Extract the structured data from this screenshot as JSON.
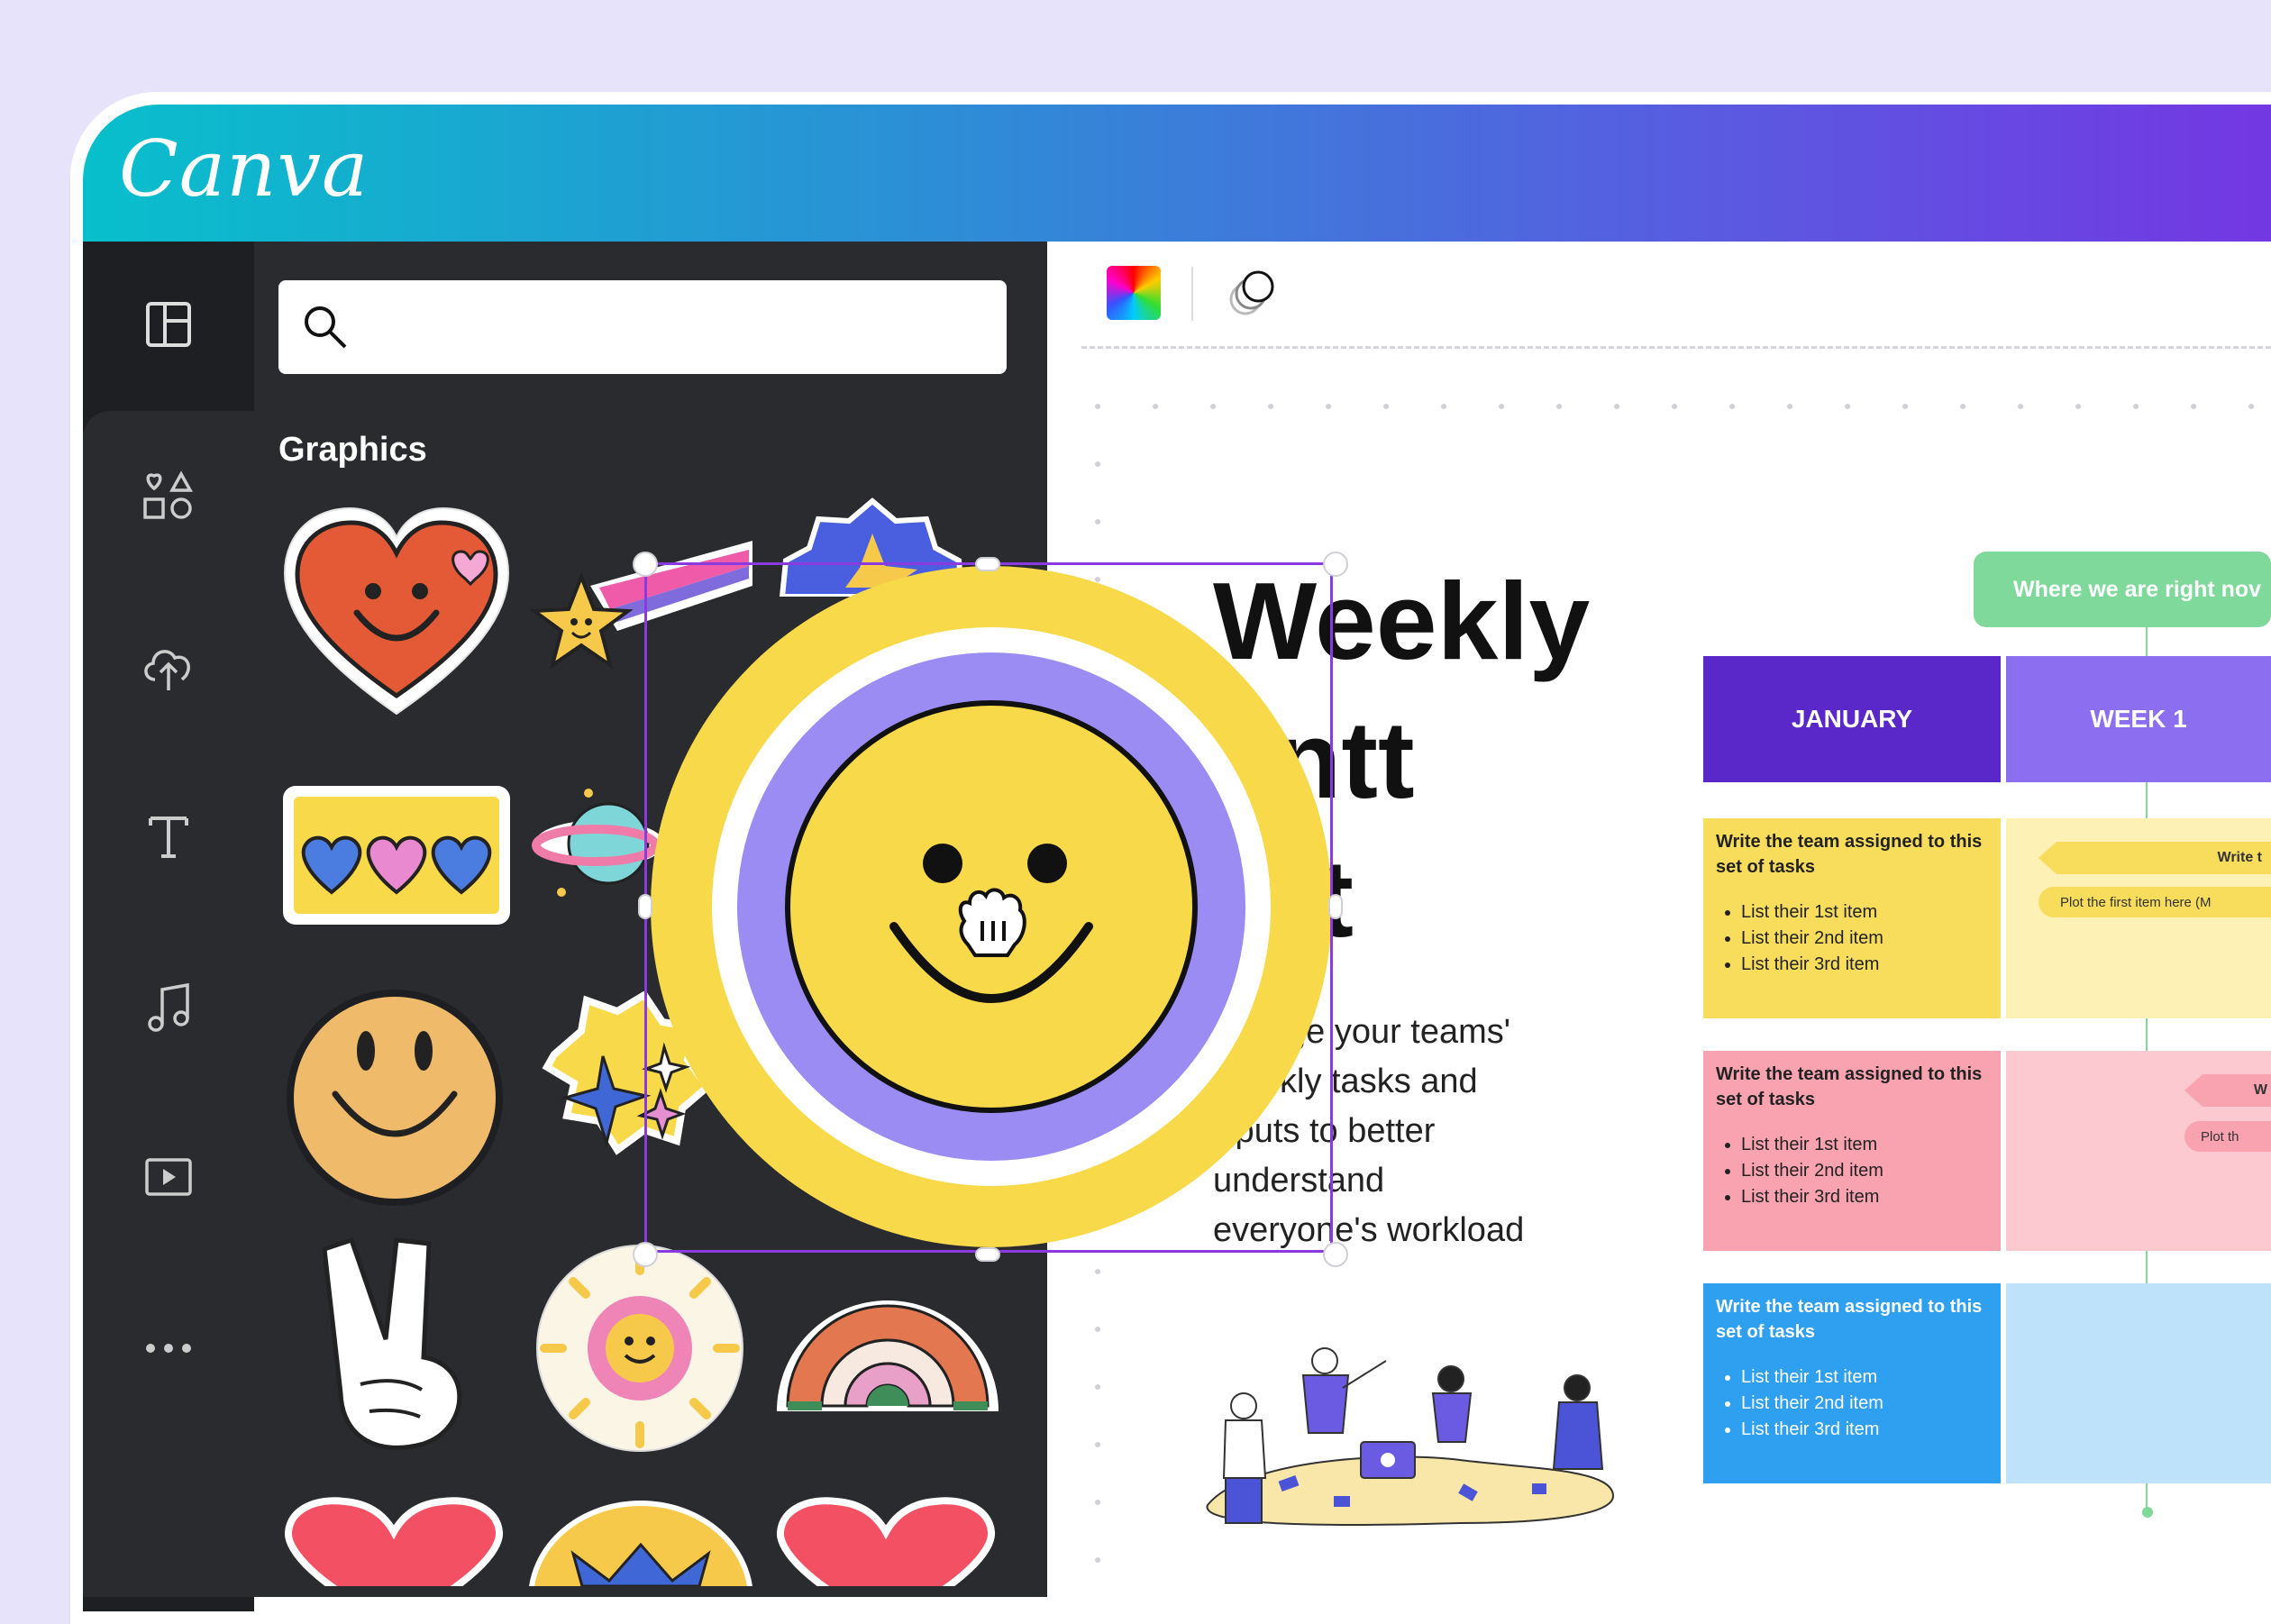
{
  "app": {
    "logo": "Canva"
  },
  "sidebar": {
    "items": [
      {
        "icon": "layout-icon"
      },
      {
        "icon": "elements-icon"
      },
      {
        "icon": "upload-cloud-icon"
      },
      {
        "icon": "text-icon"
      },
      {
        "icon": "music-icon"
      },
      {
        "icon": "video-icon"
      },
      {
        "icon": "more-icon"
      }
    ]
  },
  "panel": {
    "search": {
      "value": "",
      "placeholder": ""
    },
    "section_title": "Graphics"
  },
  "toolbar": {
    "color_icon": "color-picker-icon",
    "transparency_icon": "transparency-icon"
  },
  "design": {
    "title_lines": [
      "Weekly",
      "antt",
      "art"
    ],
    "description_lines": [
      "ge your teams'",
      "kly tasks and",
      "tputs to better",
      "understand",
      "everyone's workload"
    ]
  },
  "gantt": {
    "now_label": "Where we are right nov",
    "headers": [
      "JANUARY",
      "WEEK 1"
    ],
    "rows": [
      {
        "title": "Write the team assigned to this set of tasks",
        "items": [
          "List their 1st item",
          "List their 2nd item",
          "List their 3rd item"
        ],
        "color": "#f8dd5c",
        "cell_color": "#fdf1b6",
        "bar_label": "Write t",
        "bar_sub": "Plot the first item here (M"
      },
      {
        "title": "Write the team assigned to this set of tasks",
        "items": [
          "List their 1st item",
          "List their 2nd item",
          "List their 3rd item"
        ],
        "color": "#f9a3b0",
        "cell_color": "#fdc9d1",
        "bar_label": "W",
        "bar_sub": "Plot th"
      },
      {
        "title": "Write the team assigned to this set of tasks",
        "items": [
          "List their 1st item",
          "List their 2nd item",
          "List their 3rd item"
        ],
        "color": "#2f9ff0",
        "cell_color": "#bfe2fb",
        "bar_label": "",
        "bar_sub": ""
      }
    ]
  },
  "colors": {
    "header_january": "#5a27c9",
    "header_week": "#8b6ff0",
    "now_pill": "#7ed99a",
    "selection": "#8b3ae0"
  }
}
